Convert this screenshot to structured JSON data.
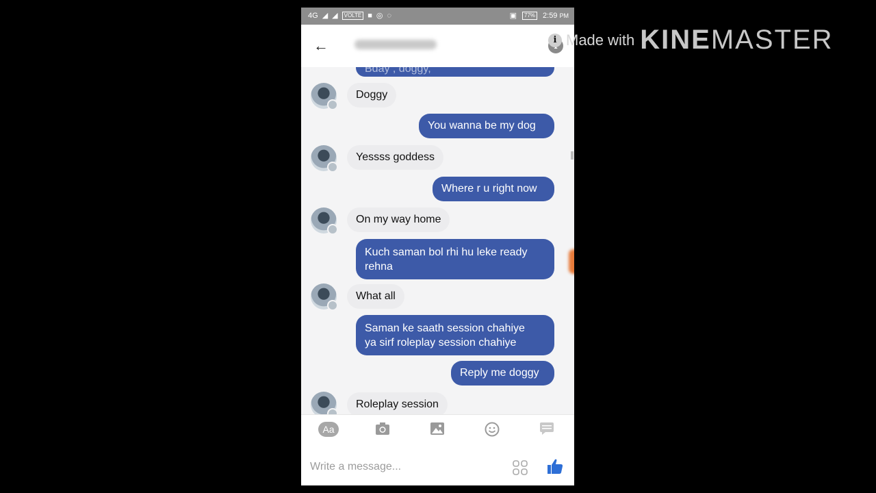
{
  "statusbar": {
    "network": "4G",
    "volte": "VOLTE",
    "battery": "77%",
    "time": "2:59",
    "ampm": "PM"
  },
  "header": {
    "back_icon": "arrow-left-icon",
    "info_icon": "info-icon"
  },
  "messages": [
    {
      "from": "me",
      "text": "Bday , doggy,"
    },
    {
      "from": "them",
      "text": "Doggy"
    },
    {
      "from": "me",
      "text": "You wanna be my dog"
    },
    {
      "from": "them",
      "text": "Yessss goddess"
    },
    {
      "from": "me",
      "text": "Where r u right now"
    },
    {
      "from": "them",
      "text": "On my way home"
    },
    {
      "from": "me",
      "line1": "Kuch saman bol rhi hu leke ready",
      "line2": "rehna"
    },
    {
      "from": "them",
      "text": "What all"
    },
    {
      "from": "me",
      "line1": "Saman ke saath session chahiye",
      "line2": "ya sirf roleplay session chahiye"
    },
    {
      "from": "me",
      "text": "Reply me doggy"
    },
    {
      "from": "them",
      "text": "Roleplay session"
    }
  ],
  "toolbar": {
    "aa_label": "Aa",
    "icons": [
      "camera-icon",
      "image-icon",
      "emoji-icon",
      "chat-icon"
    ]
  },
  "composer": {
    "placeholder": "Write a message...",
    "like_icon": "thumbs-up-icon"
  },
  "watermark": {
    "made_with": "Made with",
    "brand1": "KINE",
    "brand2": "MASTER"
  },
  "colors": {
    "outgoing": "#3d5aa8",
    "incoming": "#ececee",
    "like": "#2e6fd6"
  }
}
